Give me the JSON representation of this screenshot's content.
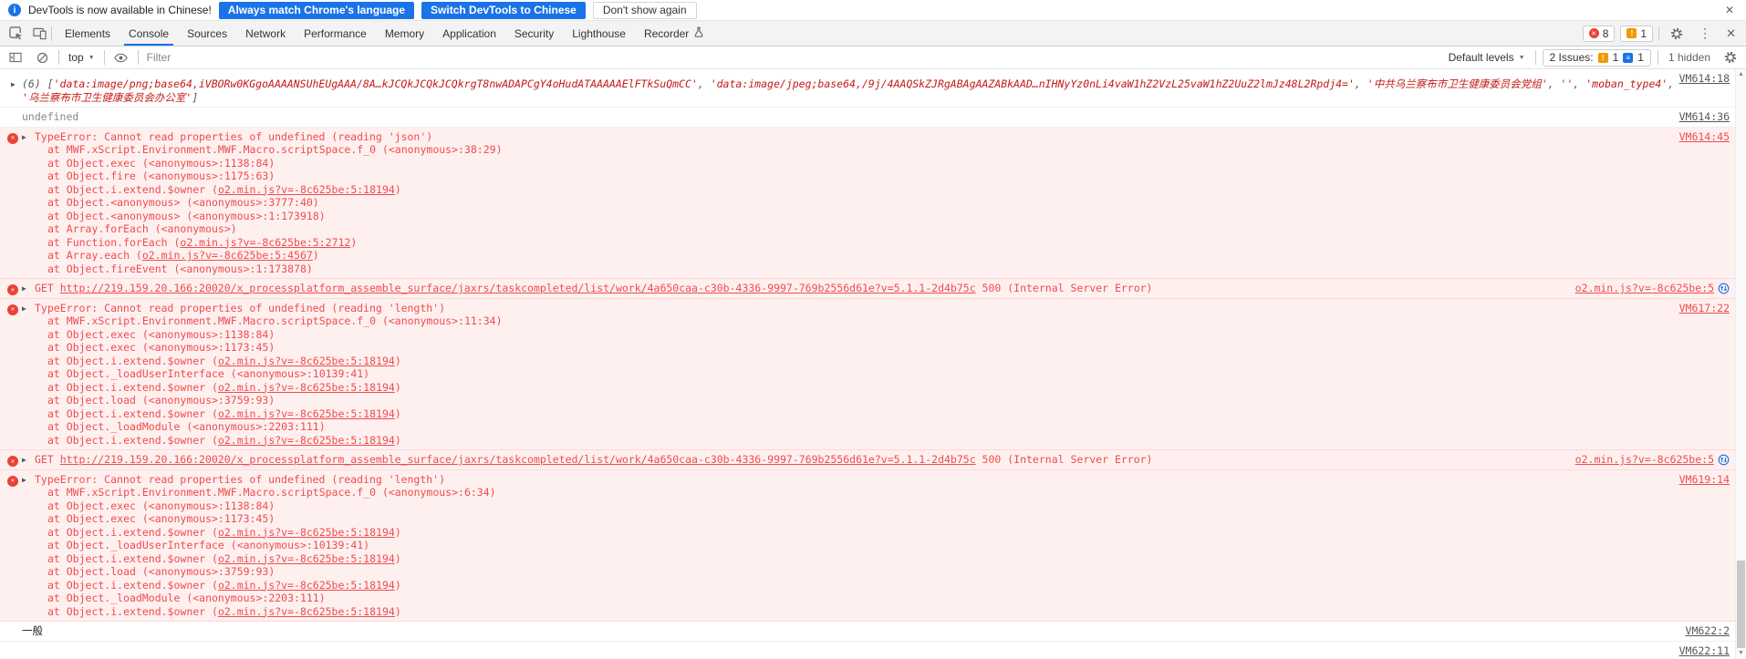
{
  "banner": {
    "text": "DevTools is now available in Chinese!",
    "primary_button": "Always match Chrome's language",
    "secondary_button": "Switch DevTools to Chinese",
    "dismiss_button": "Don't show again"
  },
  "tabs": {
    "items": [
      "Elements",
      "Console",
      "Sources",
      "Network",
      "Performance",
      "Memory",
      "Application",
      "Security",
      "Lighthouse",
      "Recorder"
    ],
    "active": "Console",
    "error_count": "8",
    "warning_count": "1"
  },
  "toolbar": {
    "context": "top",
    "filter_placeholder": "Filter",
    "levels_label": "Default levels",
    "issues_label": "2 Issues:",
    "issues_breaking_count": "1",
    "issues_info_count": "1",
    "hidden_label": "1 hidden"
  },
  "icons": {
    "info": "i",
    "close": "✕",
    "overflow": "⋮",
    "caret": "▼",
    "expand": "▶",
    "error_x": "✕",
    "warning_bang": "!",
    "issue_lines": "≡",
    "scroll_up": "▲",
    "scroll_down": "▼"
  },
  "colors": {
    "accent_blue": "#1a73e8",
    "error_text": "#ef4c4c",
    "error_background": "#fff0f0",
    "error_border": "#ffd6d6",
    "string_red": "#c41a16",
    "badge_red": "#ea4335",
    "warning_orange": "#f29900"
  },
  "console": {
    "rows": [
      {
        "type": "log",
        "first": true,
        "italic": true,
        "expandable": true,
        "link": "VM614:18",
        "parts": [
          {
            "kind": "punct",
            "text": "(6) ["
          },
          {
            "kind": "string",
            "text": "'data:image/png;base64,iVBORw0KGgoAAAANSUhEUgAAA/8A…kJCQkJCQkJCQkrgT8nwADAPCgY4oHudATAAAAAElFTkSuQmCC'"
          },
          {
            "kind": "punct",
            "text": ", "
          },
          {
            "kind": "string",
            "text": "'data:image/jpeg;base64,/9j/4AAQSkZJRgABAgAAZABkAAD…nIHNyYz0nLi4vaW1hZ2VzL25vaW1hZ2UuZ2lmJz48L2Rpdj4='"
          },
          {
            "kind": "punct",
            "text": ", "
          },
          {
            "kind": "string",
            "text": "'中共乌兰察布市卫生健康委员会党组'"
          },
          {
            "kind": "punct",
            "text": ", "
          },
          {
            "kind": "string",
            "text": "''"
          },
          {
            "kind": "punct",
            "text": ", "
          },
          {
            "kind": "string",
            "text": "'moban_type4'"
          },
          {
            "kind": "punct",
            "text": ", "
          },
          {
            "kind": "string",
            "text": "'乌兰察布市卫生健康委员会办公室'"
          },
          {
            "kind": "punct",
            "text": "]"
          }
        ]
      },
      {
        "type": "result",
        "link": "VM614:36",
        "parts": [
          {
            "kind": "muted",
            "text": "undefined"
          }
        ]
      },
      {
        "type": "error",
        "expandable": true,
        "link": "VM614:45",
        "message": "TypeError: Cannot read properties of undefined (reading 'json')",
        "frames": [
          [
            {
              "kind": "plain",
              "text": "at MWF.xScript.Environment.MWF.Macro.scriptSpace.f_0 (<anonymous>:38:29)"
            }
          ],
          [
            {
              "kind": "plain",
              "text": "at Object.exec (<anonymous>:1138:84)"
            }
          ],
          [
            {
              "kind": "plain",
              "text": "at Object.fire (<anonymous>:1175:63)"
            }
          ],
          [
            {
              "kind": "plain",
              "text": "at Object.i.extend.$owner ("
            },
            {
              "kind": "link",
              "text": "o2.min.js?v=-8c625be:5:18194"
            },
            {
              "kind": "plain",
              "text": ")"
            }
          ],
          [
            {
              "kind": "plain",
              "text": "at Object.<anonymous> (<anonymous>:3777:40)"
            }
          ],
          [
            {
              "kind": "plain",
              "text": "at Object.<anonymous> (<anonymous>:1:173918)"
            }
          ],
          [
            {
              "kind": "plain",
              "text": "at Array.forEach (<anonymous>)"
            }
          ],
          [
            {
              "kind": "plain",
              "text": "at Function.forEach ("
            },
            {
              "kind": "link",
              "text": "o2.min.js?v=-8c625be:5:2712"
            },
            {
              "kind": "plain",
              "text": ")"
            }
          ],
          [
            {
              "kind": "plain",
              "text": "at Array.each ("
            },
            {
              "kind": "link",
              "text": "o2.min.js?v=-8c625be:5:4567"
            },
            {
              "kind": "plain",
              "text": ")"
            }
          ],
          [
            {
              "kind": "plain",
              "text": "at Object.fireEvent (<anonymous>:1:173878)"
            }
          ]
        ]
      },
      {
        "type": "network",
        "expandable": true,
        "link": "o2.min.js?v=-8c625be:5",
        "initiator": true,
        "parts": [
          {
            "kind": "plain",
            "text": "GET "
          },
          {
            "kind": "url",
            "text": "http://219.159.20.166:20020/x_processplatform_assemble_surface/jaxrs/taskcompleted/list/work/4a650caa-c30b-4336-9997-769b2556d61e?v=5.1.1-2d4b75c"
          },
          {
            "kind": "plain",
            "text": " 500 (Internal Server Error)"
          }
        ]
      },
      {
        "type": "error",
        "expandable": true,
        "link": "VM617:22",
        "message": "TypeError: Cannot read properties of undefined (reading 'length')",
        "frames": [
          [
            {
              "kind": "plain",
              "text": "at MWF.xScript.Environment.MWF.Macro.scriptSpace.f_0 (<anonymous>:11:34)"
            }
          ],
          [
            {
              "kind": "plain",
              "text": "at Object.exec (<anonymous>:1138:84)"
            }
          ],
          [
            {
              "kind": "plain",
              "text": "at Object.exec (<anonymous>:1173:45)"
            }
          ],
          [
            {
              "kind": "plain",
              "text": "at Object.i.extend.$owner ("
            },
            {
              "kind": "link",
              "text": "o2.min.js?v=-8c625be:5:18194"
            },
            {
              "kind": "plain",
              "text": ")"
            }
          ],
          [
            {
              "kind": "plain",
              "text": "at Object._loadUserInterface (<anonymous>:10139:41)"
            }
          ],
          [
            {
              "kind": "plain",
              "text": "at Object.i.extend.$owner ("
            },
            {
              "kind": "link",
              "text": "o2.min.js?v=-8c625be:5:18194"
            },
            {
              "kind": "plain",
              "text": ")"
            }
          ],
          [
            {
              "kind": "plain",
              "text": "at Object.load (<anonymous>:3759:93)"
            }
          ],
          [
            {
              "kind": "plain",
              "text": "at Object.i.extend.$owner ("
            },
            {
              "kind": "link",
              "text": "o2.min.js?v=-8c625be:5:18194"
            },
            {
              "kind": "plain",
              "text": ")"
            }
          ],
          [
            {
              "kind": "plain",
              "text": "at Object._loadModule (<anonymous>:2203:111)"
            }
          ],
          [
            {
              "kind": "plain",
              "text": "at Object.i.extend.$owner ("
            },
            {
              "kind": "link",
              "text": "o2.min.js?v=-8c625be:5:18194"
            },
            {
              "kind": "plain",
              "text": ")"
            }
          ]
        ]
      },
      {
        "type": "network",
        "expandable": true,
        "link": "o2.min.js?v=-8c625be:5",
        "initiator": true,
        "parts": [
          {
            "kind": "plain",
            "text": "GET "
          },
          {
            "kind": "url",
            "text": "http://219.159.20.166:20020/x_processplatform_assemble_surface/jaxrs/taskcompleted/list/work/4a650caa-c30b-4336-9997-769b2556d61e?v=5.1.1-2d4b75c"
          },
          {
            "kind": "plain",
            "text": " 500 (Internal Server Error)"
          }
        ]
      },
      {
        "type": "error",
        "expandable": true,
        "link": "VM619:14",
        "message": "TypeError: Cannot read properties of undefined (reading 'length')",
        "frames": [
          [
            {
              "kind": "plain",
              "text": "at MWF.xScript.Environment.MWF.Macro.scriptSpace.f_0 (<anonymous>:6:34)"
            }
          ],
          [
            {
              "kind": "plain",
              "text": "at Object.exec (<anonymous>:1138:84)"
            }
          ],
          [
            {
              "kind": "plain",
              "text": "at Object.exec (<anonymous>:1173:45)"
            }
          ],
          [
            {
              "kind": "plain",
              "text": "at Object.i.extend.$owner ("
            },
            {
              "kind": "link",
              "text": "o2.min.js?v=-8c625be:5:18194"
            },
            {
              "kind": "plain",
              "text": ")"
            }
          ],
          [
            {
              "kind": "plain",
              "text": "at Object._loadUserInterface (<anonymous>:10139:41)"
            }
          ],
          [
            {
              "kind": "plain",
              "text": "at Object.i.extend.$owner ("
            },
            {
              "kind": "link",
              "text": "o2.min.js?v=-8c625be:5:18194"
            },
            {
              "kind": "plain",
              "text": ")"
            }
          ],
          [
            {
              "kind": "plain",
              "text": "at Object.load (<anonymous>:3759:93)"
            }
          ],
          [
            {
              "kind": "plain",
              "text": "at Object.i.extend.$owner ("
            },
            {
              "kind": "link",
              "text": "o2.min.js?v=-8c625be:5:18194"
            },
            {
              "kind": "plain",
              "text": ")"
            }
          ],
          [
            {
              "kind": "plain",
              "text": "at Object._loadModule (<anonymous>:2203:111)"
            }
          ],
          [
            {
              "kind": "plain",
              "text": "at Object.i.extend.$owner ("
            },
            {
              "kind": "link",
              "text": "o2.min.js?v=-8c625be:5:18194"
            },
            {
              "kind": "plain",
              "text": ")"
            }
          ]
        ]
      },
      {
        "type": "log",
        "link": "VM622:2",
        "parts": [
          {
            "kind": "dark",
            "text": "一般"
          }
        ]
      },
      {
        "type": "log",
        "link": "VM622:11",
        "parts": []
      }
    ]
  }
}
